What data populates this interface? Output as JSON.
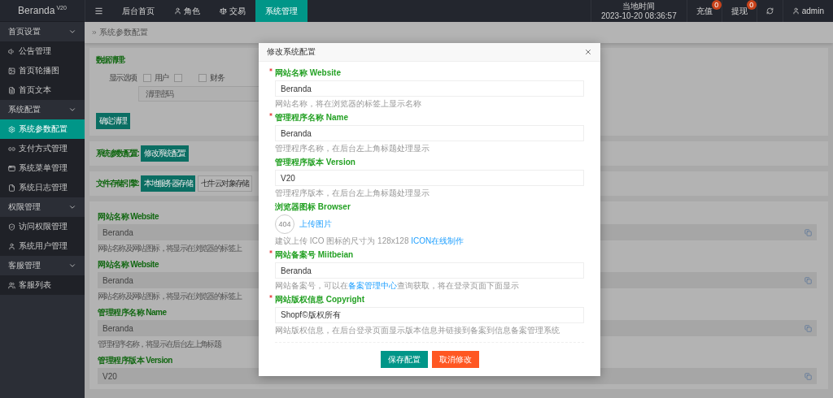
{
  "header": {
    "logo": {
      "name": "Beranda",
      "version": "V20"
    },
    "nav_tabs": [
      {
        "label": "后台首页",
        "selected": false
      },
      {
        "label": "角色",
        "selected": false
      },
      {
        "label": "交易",
        "selected": false
      },
      {
        "label": "系统管理",
        "selected": true
      }
    ],
    "clock": {
      "label": "当地时间",
      "time": "2023-10-20 08:36:57"
    },
    "actions": [
      {
        "label": "充值",
        "badge": "0"
      },
      {
        "label": "提现",
        "badge": "0"
      }
    ],
    "user": "admin"
  },
  "sidebar": {
    "groups": [
      {
        "label": "首页设置",
        "expanded": true,
        "items": [
          {
            "label": "公告管理",
            "selected": false
          },
          {
            "label": "首页轮播图",
            "selected": false
          },
          {
            "label": "首页文本",
            "selected": false
          }
        ]
      },
      {
        "label": "系统配置",
        "expanded": true,
        "items": [
          {
            "label": "系统参数配置",
            "selected": true
          },
          {
            "label": "支付方式管理",
            "selected": false
          },
          {
            "label": "系统菜单管理",
            "selected": false
          },
          {
            "label": "系统日志管理",
            "selected": false
          }
        ]
      },
      {
        "label": "权限管理",
        "expanded": true,
        "items": [
          {
            "label": "访问权限管理",
            "selected": false
          },
          {
            "label": "系统用户管理",
            "selected": false
          }
        ]
      },
      {
        "label": "客服管理",
        "expanded": true,
        "items": [
          {
            "label": "客服列表",
            "selected": false
          }
        ]
      }
    ]
  },
  "breadcrumb": "系统参数配置",
  "cleanup_card": {
    "title": "数据清理:",
    "options_label": "显示选项",
    "options": [
      {
        "label": "用户",
        "checked": false
      },
      {
        "checked": false
      },
      {
        "label": "财务",
        "checked": false
      }
    ],
    "password_placeholder": "清理密码",
    "button": "确定清理"
  },
  "config_card": {
    "title": "系统参数配置:",
    "button": "修改系统配置"
  },
  "storage_card": {
    "title": "文件存储引擎:",
    "engines": [
      {
        "label": "本地服务器存储",
        "selected": true
      },
      {
        "label": "七牛云对象存储",
        "selected": false
      }
    ]
  },
  "settings_form": {
    "fields": [
      {
        "label": "网站名称 Website",
        "value": "Beranda",
        "hint": "网站名称及网站图标，将显示在浏览器的标签上"
      },
      {
        "label": "网站名称 Website",
        "value": "Beranda",
        "hint": "网站名称及网站图标，将显示在浏览器的标签上"
      },
      {
        "label": "管理程序名称 Name",
        "value": "Beranda",
        "hint": "管理程序名称，将显示在后台左上角标题"
      },
      {
        "label": "管理程序版本 Version",
        "value": "V20"
      }
    ]
  },
  "modal": {
    "title": "修改系统配置",
    "fields": [
      {
        "kind": "text",
        "required": true,
        "label": "网站名称 Website",
        "value": "Beranda",
        "hint": [
          {
            "text": "网站名称，将在浏览器的标签上显示名称"
          }
        ]
      },
      {
        "kind": "text",
        "required": true,
        "label": "管理程序名称 Name",
        "value": "Beranda",
        "hint": [
          {
            "text": "管理程序名称，在后台左上角标题处理显示"
          }
        ]
      },
      {
        "kind": "text",
        "required": false,
        "label": "管理程序版本 Version",
        "value": "V20",
        "hint": [
          {
            "text": "管理程序版本，在后台左上角标题处理显示"
          }
        ]
      },
      {
        "kind": "image",
        "required": false,
        "label": "浏览器图标 Browser",
        "image_text": "404",
        "upload": "上传图片",
        "hint": [
          {
            "text": "建议上传 ICO 图标的尺寸为 128x128 "
          },
          {
            "text": "ICON在线制作",
            "link": true
          }
        ]
      },
      {
        "kind": "text",
        "required": true,
        "label": "网站备案号 Miitbeian",
        "value": "Beranda",
        "hint": [
          {
            "text": "网站备案号，可以在"
          },
          {
            "text": "备案管理中心",
            "link": true
          },
          {
            "text": "查询获取，将在登录页面下面显示"
          }
        ]
      },
      {
        "kind": "text",
        "required": true,
        "label": "网站版权信息 Copyright",
        "value": "Shopf©版权所有",
        "hint": [
          {
            "text": "网站版权信息，在后台登录页面显示版本信息并链接到备案到信息备案管理系统"
          }
        ]
      }
    ],
    "buttons": [
      {
        "label": "保存配置",
        "kind": "primary"
      },
      {
        "label": "取消修改",
        "kind": "danger"
      }
    ]
  }
}
